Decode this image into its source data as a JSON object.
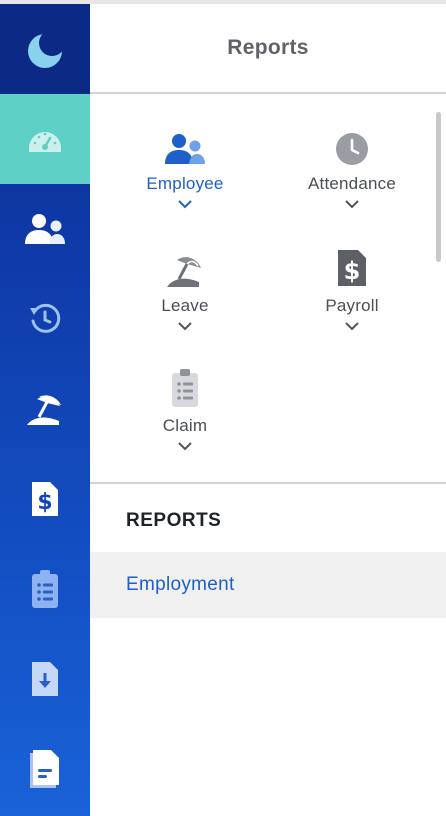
{
  "panel": {
    "title": "Reports"
  },
  "sidebar": {
    "items": [
      {
        "icon": "dashboard-gauge-icon",
        "active": true
      },
      {
        "icon": "people-icon"
      },
      {
        "icon": "history-clock-icon"
      },
      {
        "icon": "beach-leave-icon"
      },
      {
        "icon": "payroll-dollar-icon"
      },
      {
        "icon": "clipboard-icon"
      },
      {
        "icon": "download-document-icon"
      },
      {
        "icon": "document-lines-icon"
      }
    ]
  },
  "categories": [
    {
      "label": "Employee",
      "icon": "people-icon",
      "active": true
    },
    {
      "label": "Attendance",
      "icon": "clock-icon"
    },
    {
      "label": "Leave",
      "icon": "beach-umbrella-icon"
    },
    {
      "label": "Payroll",
      "icon": "dollar-document-icon"
    },
    {
      "label": "Claim",
      "icon": "clipboard-icon"
    }
  ],
  "reports_section": {
    "heading": "REPORTS",
    "items": [
      "Employment"
    ]
  },
  "colors": {
    "accent": "#1f5fc8",
    "rail_dark": "#0b2a8a",
    "rail_active": "#5ed0c6"
  }
}
